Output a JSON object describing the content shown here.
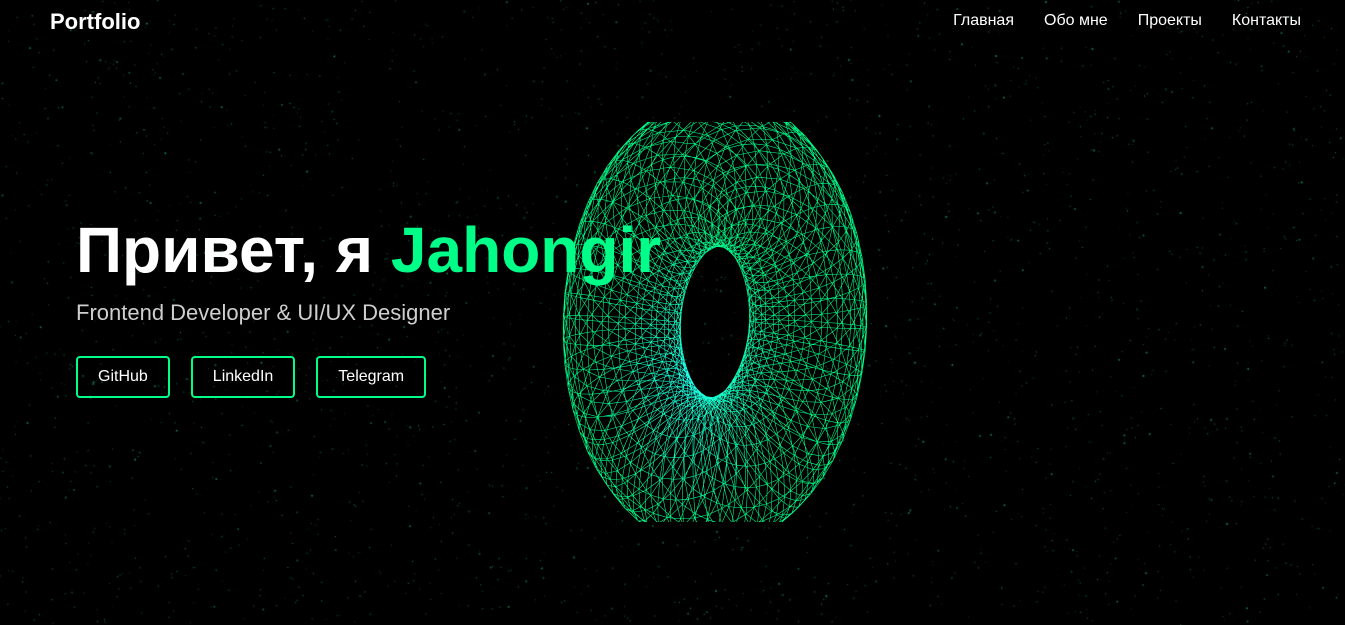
{
  "theme": {
    "background": "#000000",
    "accent": "#00ff88",
    "torus_inner": "#22ffee",
    "star": "#1fae73"
  },
  "navbar": {
    "logo": "Portfolio",
    "links": [
      {
        "label": "Главная"
      },
      {
        "label": "Обо мне"
      },
      {
        "label": "Проекты"
      },
      {
        "label": "Контакты"
      }
    ]
  },
  "hero": {
    "greeting": "Привет, я",
    "name": "Jahongir",
    "subtitle": "Frontend Developer & UI/UX Designer",
    "buttons": [
      {
        "label": "GitHub"
      },
      {
        "label": "LinkedIn"
      },
      {
        "label": "Telegram"
      }
    ]
  },
  "decor": {
    "background_effect": "particle-starfield",
    "centerpiece": "wireframe-torus"
  }
}
